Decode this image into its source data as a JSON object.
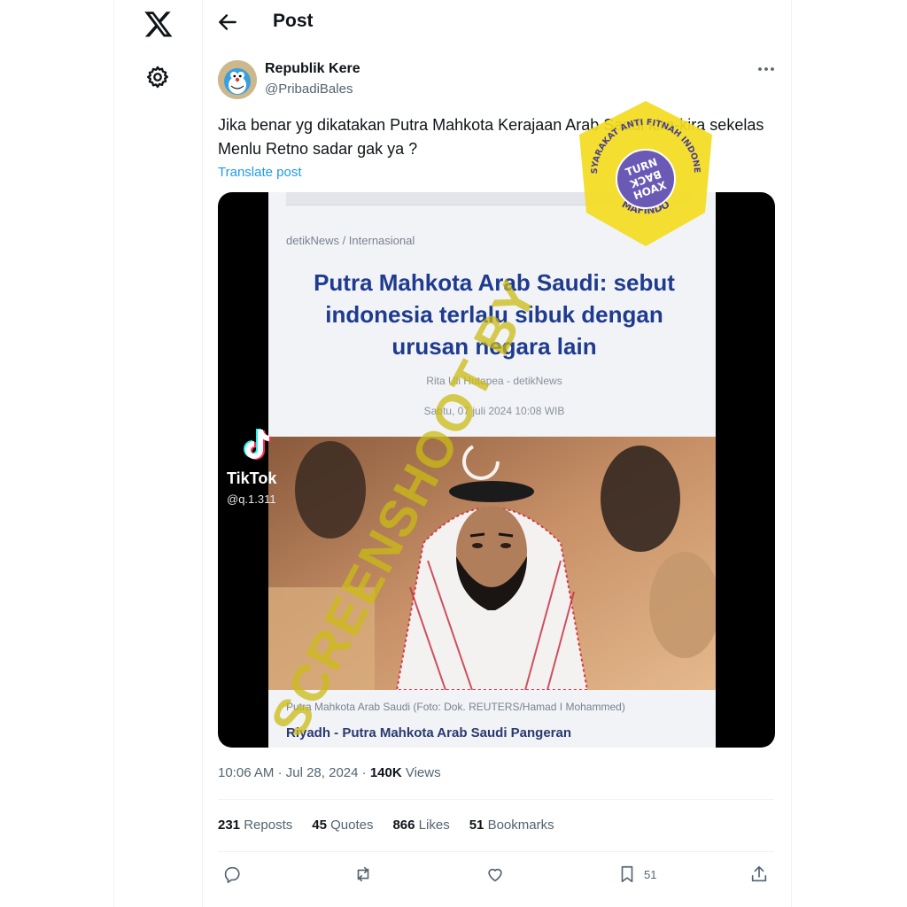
{
  "page": {
    "title": "Post"
  },
  "author": {
    "name": "Republik Kere",
    "handle": "@PribadiBales"
  },
  "tweet": {
    "text": "Jika benar yg dikatakan Putra Mahkota Kerajaan Arab Saudi kira-kira sekelas Menlu Retno sadar gak ya ?",
    "translate_label": "Translate post"
  },
  "media": {
    "source": "detikNews / Internasional",
    "headline": "Putra Mahkota Arab Saudi: sebut indonesia terlalu sibuk dengan urusan negara lain",
    "byline": "Rita Uli Hutapea - detikNews",
    "date": "Sabtu, 07 juli 2024 10:08 WIB",
    "caption": "Putra Mahkota Arab Saudi (Foto: Dok. REUTERS/Hamad I Mohammed)",
    "lead": "Riyadh - Putra Mahkota Arab Saudi Pangeran",
    "tiktok_name": "TikTok",
    "tiktok_handle": "@q.1.311"
  },
  "overlay": {
    "watermark": "SCREENSHOOT BY",
    "stamp_inner": [
      "TURN",
      "BACK",
      "HOAX"
    ],
    "stamp_ring_top": "MASYARAKAT ANTI FITNAH INDONESIA",
    "stamp_ring_bottom": "MAFINDO"
  },
  "meta": {
    "time": "10:06 AM",
    "sep": "·",
    "date": "Jul 28, 2024",
    "views_count": "140K",
    "views_label": "Views"
  },
  "stats": {
    "reposts_count": "231",
    "reposts_label": "Reposts",
    "quotes_count": "45",
    "quotes_label": "Quotes",
    "likes_count": "866",
    "likes_label": "Likes",
    "bookmarks_count": "51",
    "bookmarks_label": "Bookmarks"
  },
  "actions": {
    "bookmark_count": "51"
  },
  "colors": {
    "accent": "#1d9bf0",
    "text": "#0f1419",
    "muted": "#536471",
    "headline": "#1f3b8f",
    "stamp": "#f3dc1f",
    "stamp_inner": "#6b5ab5"
  }
}
